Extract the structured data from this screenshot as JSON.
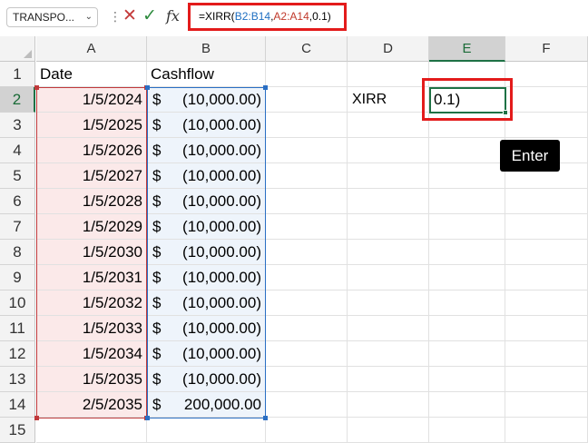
{
  "formula_bar": {
    "name_box": "TRANSPO...",
    "cancel_icon": "✕",
    "enter_icon": "✓",
    "fx_label": "fx",
    "formula": {
      "prefix": "=XIRR(",
      "ref1": "B2:B14",
      "comma1": ",",
      "ref2": "A2:A14",
      "suffix": ",0.1)"
    }
  },
  "columns": [
    "A",
    "B",
    "C",
    "D",
    "E",
    "F"
  ],
  "rows": [
    "1",
    "2",
    "3",
    "4",
    "5",
    "6",
    "7",
    "8",
    "9",
    "10",
    "11",
    "12",
    "13",
    "14",
    "15"
  ],
  "sheet": {
    "header": {
      "date": "Date",
      "cashflow": "Cashflow"
    },
    "dates": [
      "1/5/2024",
      "1/5/2025",
      "1/5/2026",
      "1/5/2027",
      "1/5/2028",
      "1/5/2029",
      "1/5/2030",
      "1/5/2031",
      "1/5/2032",
      "1/5/2033",
      "1/5/2034",
      "1/5/2035",
      "2/5/2035"
    ],
    "cashflows": [
      "(10,000.00)",
      "(10,000.00)",
      "(10,000.00)",
      "(10,000.00)",
      "(10,000.00)",
      "(10,000.00)",
      "(10,000.00)",
      "(10,000.00)",
      "(10,000.00)",
      "(10,000.00)",
      "(10,000.00)",
      "(10,000.00)",
      "200,000.00"
    ],
    "currency_symbol": "$",
    "xirr_label": "XIRR",
    "active_value": "0.1)"
  },
  "tooltip": "Enter",
  "colors": {
    "highlight_red": "#e31b1b",
    "range_blue": "#2a6fc4",
    "range_red": "#c0393b",
    "excel_green": "#1e7145"
  }
}
